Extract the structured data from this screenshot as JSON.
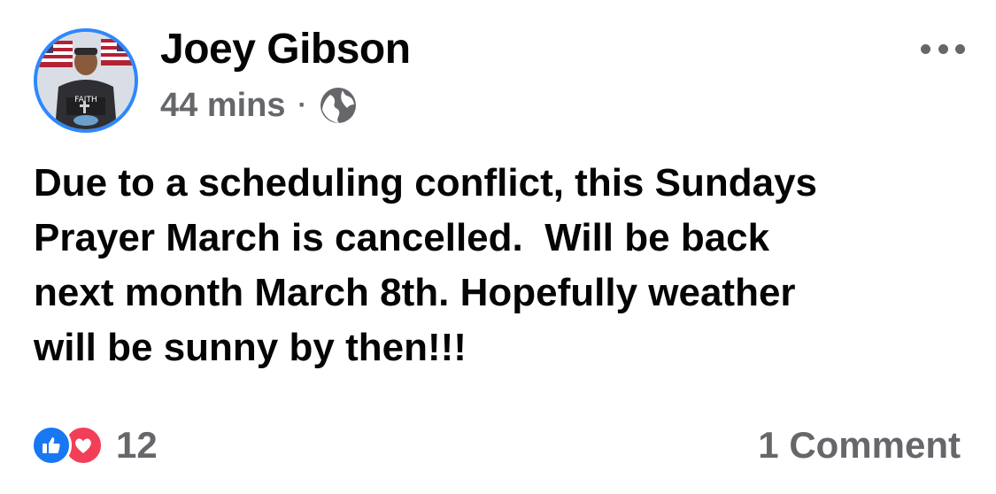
{
  "post": {
    "author": "Joey Gibson",
    "time": "44 mins",
    "separator": "·",
    "privacy_icon": "globe-icon",
    "avatar_text": "FAITH",
    "body": "Due to a scheduling conflict, this Sundays\nPrayer March is cancelled.  Will be back\nnext month March 8th. Hopefully weather\nwill be sunny by then!!!",
    "reactions": {
      "icons": [
        "like-icon",
        "love-icon"
      ],
      "count": "12"
    },
    "comments_label": "1 Comment",
    "menu_icon": "more-options-icon"
  },
  "colors": {
    "accent": "#1877f2",
    "love": "#f33e58",
    "secondary_text": "#65676b",
    "avatar_ring": "#2d88ff"
  }
}
